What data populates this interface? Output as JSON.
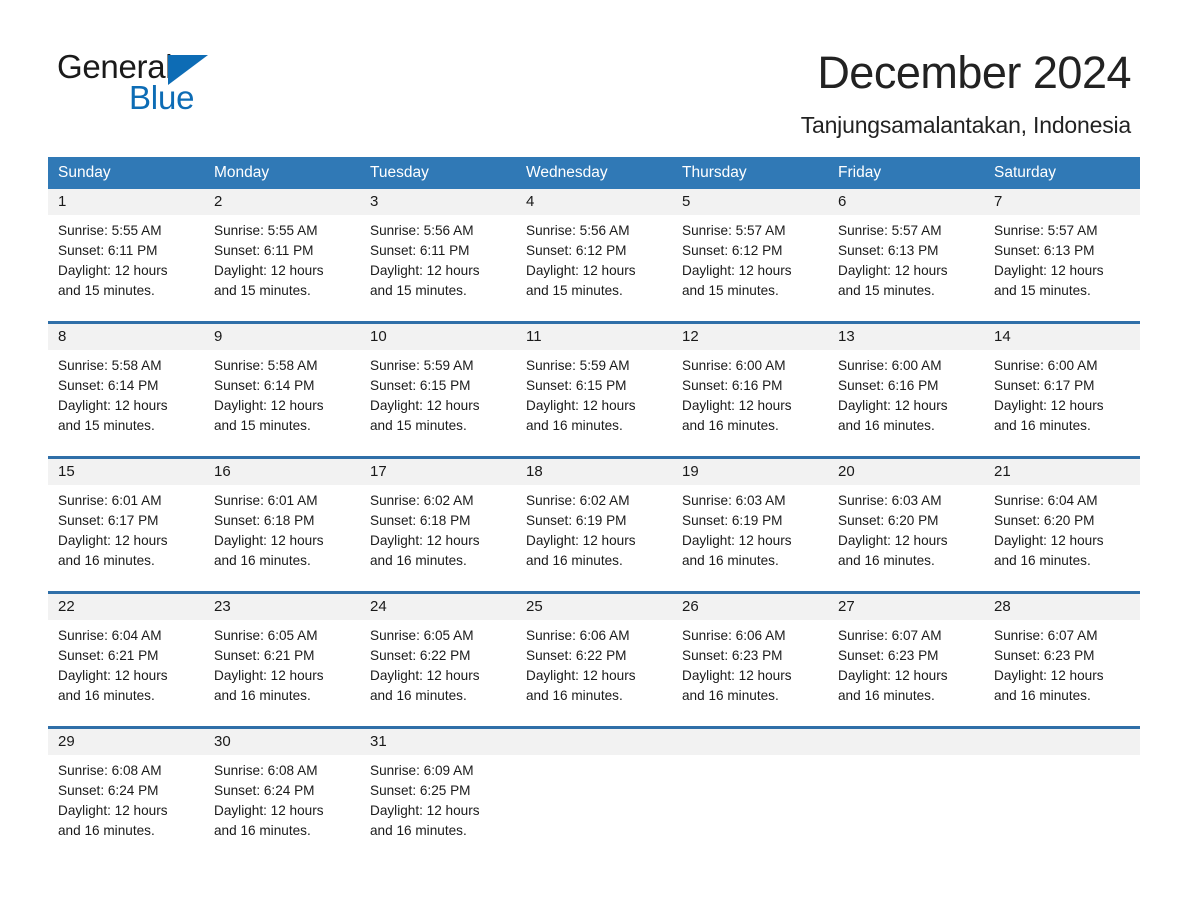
{
  "brand": {
    "name_part1": "General",
    "name_part2": "Blue",
    "triangle_icon": "triangle-icon",
    "accent_color": "#0d6cb5"
  },
  "header": {
    "title": "December 2024",
    "subtitle": "Tanjungsamalantakan, Indonesia"
  },
  "calendar": {
    "header_bg": "#3079b6",
    "row_divider_color": "#2f6fa8",
    "daynum_bg": "#f2f2f2",
    "weekdays": [
      "Sunday",
      "Monday",
      "Tuesday",
      "Wednesday",
      "Thursday",
      "Friday",
      "Saturday"
    ],
    "weeks": [
      {
        "days": [
          {
            "date": "1",
            "sunrise": "Sunrise: 5:55 AM",
            "sunset": "Sunset: 6:11 PM",
            "daylight_line1": "Daylight: 12 hours",
            "daylight_line2": "and 15 minutes."
          },
          {
            "date": "2",
            "sunrise": "Sunrise: 5:55 AM",
            "sunset": "Sunset: 6:11 PM",
            "daylight_line1": "Daylight: 12 hours",
            "daylight_line2": "and 15 minutes."
          },
          {
            "date": "3",
            "sunrise": "Sunrise: 5:56 AM",
            "sunset": "Sunset: 6:11 PM",
            "daylight_line1": "Daylight: 12 hours",
            "daylight_line2": "and 15 minutes."
          },
          {
            "date": "4",
            "sunrise": "Sunrise: 5:56 AM",
            "sunset": "Sunset: 6:12 PM",
            "daylight_line1": "Daylight: 12 hours",
            "daylight_line2": "and 15 minutes."
          },
          {
            "date": "5",
            "sunrise": "Sunrise: 5:57 AM",
            "sunset": "Sunset: 6:12 PM",
            "daylight_line1": "Daylight: 12 hours",
            "daylight_line2": "and 15 minutes."
          },
          {
            "date": "6",
            "sunrise": "Sunrise: 5:57 AM",
            "sunset": "Sunset: 6:13 PM",
            "daylight_line1": "Daylight: 12 hours",
            "daylight_line2": "and 15 minutes."
          },
          {
            "date": "7",
            "sunrise": "Sunrise: 5:57 AM",
            "sunset": "Sunset: 6:13 PM",
            "daylight_line1": "Daylight: 12 hours",
            "daylight_line2": "and 15 minutes."
          }
        ]
      },
      {
        "days": [
          {
            "date": "8",
            "sunrise": "Sunrise: 5:58 AM",
            "sunset": "Sunset: 6:14 PM",
            "daylight_line1": "Daylight: 12 hours",
            "daylight_line2": "and 15 minutes."
          },
          {
            "date": "9",
            "sunrise": "Sunrise: 5:58 AM",
            "sunset": "Sunset: 6:14 PM",
            "daylight_line1": "Daylight: 12 hours",
            "daylight_line2": "and 15 minutes."
          },
          {
            "date": "10",
            "sunrise": "Sunrise: 5:59 AM",
            "sunset": "Sunset: 6:15 PM",
            "daylight_line1": "Daylight: 12 hours",
            "daylight_line2": "and 15 minutes."
          },
          {
            "date": "11",
            "sunrise": "Sunrise: 5:59 AM",
            "sunset": "Sunset: 6:15 PM",
            "daylight_line1": "Daylight: 12 hours",
            "daylight_line2": "and 16 minutes."
          },
          {
            "date": "12",
            "sunrise": "Sunrise: 6:00 AM",
            "sunset": "Sunset: 6:16 PM",
            "daylight_line1": "Daylight: 12 hours",
            "daylight_line2": "and 16 minutes."
          },
          {
            "date": "13",
            "sunrise": "Sunrise: 6:00 AM",
            "sunset": "Sunset: 6:16 PM",
            "daylight_line1": "Daylight: 12 hours",
            "daylight_line2": "and 16 minutes."
          },
          {
            "date": "14",
            "sunrise": "Sunrise: 6:00 AM",
            "sunset": "Sunset: 6:17 PM",
            "daylight_line1": "Daylight: 12 hours",
            "daylight_line2": "and 16 minutes."
          }
        ]
      },
      {
        "days": [
          {
            "date": "15",
            "sunrise": "Sunrise: 6:01 AM",
            "sunset": "Sunset: 6:17 PM",
            "daylight_line1": "Daylight: 12 hours",
            "daylight_line2": "and 16 minutes."
          },
          {
            "date": "16",
            "sunrise": "Sunrise: 6:01 AM",
            "sunset": "Sunset: 6:18 PM",
            "daylight_line1": "Daylight: 12 hours",
            "daylight_line2": "and 16 minutes."
          },
          {
            "date": "17",
            "sunrise": "Sunrise: 6:02 AM",
            "sunset": "Sunset: 6:18 PM",
            "daylight_line1": "Daylight: 12 hours",
            "daylight_line2": "and 16 minutes."
          },
          {
            "date": "18",
            "sunrise": "Sunrise: 6:02 AM",
            "sunset": "Sunset: 6:19 PM",
            "daylight_line1": "Daylight: 12 hours",
            "daylight_line2": "and 16 minutes."
          },
          {
            "date": "19",
            "sunrise": "Sunrise: 6:03 AM",
            "sunset": "Sunset: 6:19 PM",
            "daylight_line1": "Daylight: 12 hours",
            "daylight_line2": "and 16 minutes."
          },
          {
            "date": "20",
            "sunrise": "Sunrise: 6:03 AM",
            "sunset": "Sunset: 6:20 PM",
            "daylight_line1": "Daylight: 12 hours",
            "daylight_line2": "and 16 minutes."
          },
          {
            "date": "21",
            "sunrise": "Sunrise: 6:04 AM",
            "sunset": "Sunset: 6:20 PM",
            "daylight_line1": "Daylight: 12 hours",
            "daylight_line2": "and 16 minutes."
          }
        ]
      },
      {
        "days": [
          {
            "date": "22",
            "sunrise": "Sunrise: 6:04 AM",
            "sunset": "Sunset: 6:21 PM",
            "daylight_line1": "Daylight: 12 hours",
            "daylight_line2": "and 16 minutes."
          },
          {
            "date": "23",
            "sunrise": "Sunrise: 6:05 AM",
            "sunset": "Sunset: 6:21 PM",
            "daylight_line1": "Daylight: 12 hours",
            "daylight_line2": "and 16 minutes."
          },
          {
            "date": "24",
            "sunrise": "Sunrise: 6:05 AM",
            "sunset": "Sunset: 6:22 PM",
            "daylight_line1": "Daylight: 12 hours",
            "daylight_line2": "and 16 minutes."
          },
          {
            "date": "25",
            "sunrise": "Sunrise: 6:06 AM",
            "sunset": "Sunset: 6:22 PM",
            "daylight_line1": "Daylight: 12 hours",
            "daylight_line2": "and 16 minutes."
          },
          {
            "date": "26",
            "sunrise": "Sunrise: 6:06 AM",
            "sunset": "Sunset: 6:23 PM",
            "daylight_line1": "Daylight: 12 hours",
            "daylight_line2": "and 16 minutes."
          },
          {
            "date": "27",
            "sunrise": "Sunrise: 6:07 AM",
            "sunset": "Sunset: 6:23 PM",
            "daylight_line1": "Daylight: 12 hours",
            "daylight_line2": "and 16 minutes."
          },
          {
            "date": "28",
            "sunrise": "Sunrise: 6:07 AM",
            "sunset": "Sunset: 6:23 PM",
            "daylight_line1": "Daylight: 12 hours",
            "daylight_line2": "and 16 minutes."
          }
        ]
      },
      {
        "days": [
          {
            "date": "29",
            "sunrise": "Sunrise: 6:08 AM",
            "sunset": "Sunset: 6:24 PM",
            "daylight_line1": "Daylight: 12 hours",
            "daylight_line2": "and 16 minutes."
          },
          {
            "date": "30",
            "sunrise": "Sunrise: 6:08 AM",
            "sunset": "Sunset: 6:24 PM",
            "daylight_line1": "Daylight: 12 hours",
            "daylight_line2": "and 16 minutes."
          },
          {
            "date": "31",
            "sunrise": "Sunrise: 6:09 AM",
            "sunset": "Sunset: 6:25 PM",
            "daylight_line1": "Daylight: 12 hours",
            "daylight_line2": "and 16 minutes."
          },
          {
            "date": "",
            "sunrise": "",
            "sunset": "",
            "daylight_line1": "",
            "daylight_line2": ""
          },
          {
            "date": "",
            "sunrise": "",
            "sunset": "",
            "daylight_line1": "",
            "daylight_line2": ""
          },
          {
            "date": "",
            "sunrise": "",
            "sunset": "",
            "daylight_line1": "",
            "daylight_line2": ""
          },
          {
            "date": "",
            "sunrise": "",
            "sunset": "",
            "daylight_line1": "",
            "daylight_line2": ""
          }
        ]
      }
    ]
  }
}
